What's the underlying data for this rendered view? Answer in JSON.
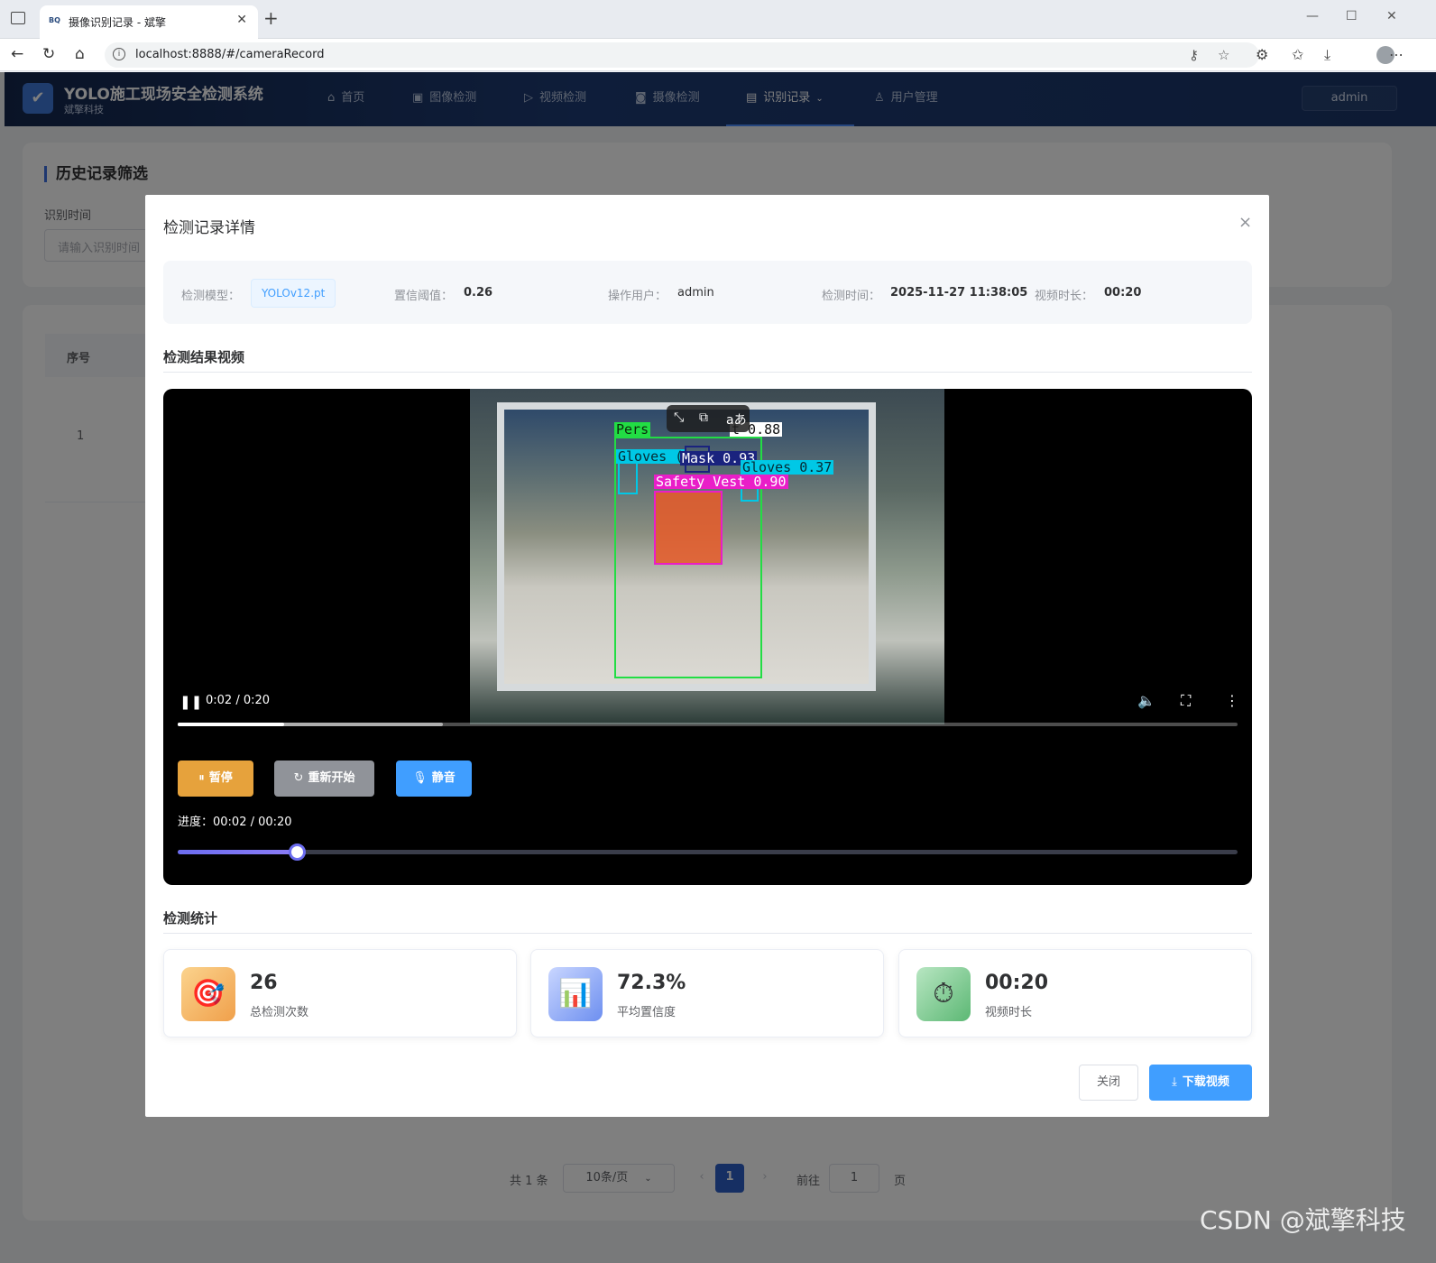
{
  "browser": {
    "tab_title": "摄像识别记录 - 斌擎",
    "tab_favicon": "BQ",
    "url": "localhost:8888/#/cameraRecord"
  },
  "header": {
    "brand_title": "YOLO施工现场安全检测系统",
    "brand_sub": "斌擎科技",
    "nav": [
      {
        "label": "首页",
        "icon": "home-icon"
      },
      {
        "label": "图像检测",
        "icon": "image-icon"
      },
      {
        "label": "视频检测",
        "icon": "play-icon"
      },
      {
        "label": "摄像检测",
        "icon": "camera-icon"
      },
      {
        "label": "识别记录",
        "icon": "document-icon"
      },
      {
        "label": "用户管理",
        "icon": "user-icon"
      }
    ],
    "user": "admin"
  },
  "filter": {
    "title": "历史记录筛选",
    "time_label": "识别时间",
    "time_placeholder": "请输入识别时间"
  },
  "table": {
    "col_seq": "序号",
    "rows": [
      {
        "seq": "1"
      }
    ]
  },
  "pagination": {
    "total": "共 1 条",
    "page_size": "10条/页",
    "prev": "‹",
    "current": "1",
    "next": "›",
    "goto_label": "前往",
    "goto_value": "1",
    "page_suffix": "页"
  },
  "dialog": {
    "title": "检测记录详情",
    "close": "×",
    "info": {
      "model_label": "检测模型：",
      "model_value": "YOLOv12.pt",
      "conf_label": "置信阈值：",
      "conf_value": "0.26",
      "user_label": "操作用户：",
      "user_value": "admin",
      "time_label": "检测时间：",
      "time_value": "2025-11-27 11:38:05",
      "duration_label": "视频时长：",
      "duration_value": "00:20"
    },
    "video_section_title": "检测结果视频",
    "video": {
      "time_display": "0:02 / 0:20",
      "played_fraction": 0.1,
      "buffered_fraction": 0.25,
      "detections": [
        {
          "label": "Person 0.88",
          "visible": "Pers",
          "visible_right": "t 0.88",
          "color": "#22dd44"
        },
        {
          "label": "Gloves",
          "visible": "Gloves (",
          "color": "#00c8e6"
        },
        {
          "label": "Mask 0.93",
          "visible": "Mask 0.93",
          "color": "#1a237e"
        },
        {
          "label": "Gloves 0.37",
          "visible": "Gloves 0.37",
          "color": "#00c8e6"
        },
        {
          "label": "Safety Vest 0.90",
          "visible": "Safety Vest 0.90",
          "color": "#e91ec8"
        }
      ]
    },
    "buttons": {
      "pause": "暂停",
      "restart": "重新开始",
      "mute": "静音"
    },
    "progress_text": "进度：00:02 / 00:20",
    "progress_fraction": 0.112,
    "stats_section_title": "检测统计",
    "stats": [
      {
        "value": "26",
        "label": "总检测次数",
        "icon": "target-icon"
      },
      {
        "value": "72.3%",
        "label": "平均置信度",
        "icon": "bar-chart-icon"
      },
      {
        "value": "00:20",
        "label": "视频时长",
        "icon": "stopwatch-icon"
      }
    ],
    "footer": {
      "close": "关闭",
      "download": "下载视频"
    }
  },
  "watermark": "CSDN @斌擎科技",
  "colors": {
    "primary": "#409eff",
    "warning": "#e6a23c",
    "info": "#909399",
    "header_bg": "#1d3b74"
  }
}
